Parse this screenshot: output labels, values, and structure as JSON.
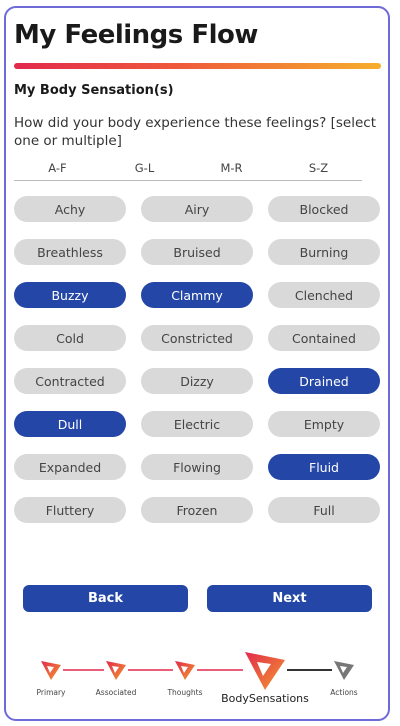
{
  "page": {
    "title": "My Feelings Flow"
  },
  "section": {
    "label": "My Body Sensation(s)",
    "question": "How did your body experience these feelings? [select one or multiple]"
  },
  "alpha_tabs": [
    "A-F",
    "G-L",
    "M-R",
    "S-Z"
  ],
  "sensations": [
    {
      "label": "Achy",
      "selected": false
    },
    {
      "label": "Airy",
      "selected": false
    },
    {
      "label": "Blocked",
      "selected": false
    },
    {
      "label": "Breathless",
      "selected": false
    },
    {
      "label": "Bruised",
      "selected": false
    },
    {
      "label": "Burning",
      "selected": false
    },
    {
      "label": "Buzzy",
      "selected": true
    },
    {
      "label": "Clammy",
      "selected": true
    },
    {
      "label": "Clenched",
      "selected": false
    },
    {
      "label": "Cold",
      "selected": false
    },
    {
      "label": "Constricted",
      "selected": false
    },
    {
      "label": "Contained",
      "selected": false
    },
    {
      "label": "Contracted",
      "selected": false
    },
    {
      "label": "Dizzy",
      "selected": false
    },
    {
      "label": "Drained",
      "selected": true
    },
    {
      "label": "Dull",
      "selected": true
    },
    {
      "label": "Electric",
      "selected": false
    },
    {
      "label": "Empty",
      "selected": false
    },
    {
      "label": "Expanded",
      "selected": false
    },
    {
      "label": "Flowing",
      "selected": false
    },
    {
      "label": "Fluid",
      "selected": true
    },
    {
      "label": "Fluttery",
      "selected": false
    },
    {
      "label": "Frozen",
      "selected": false
    },
    {
      "label": "Full",
      "selected": false
    }
  ],
  "buttons": {
    "back": "Back",
    "next": "Next"
  },
  "progress": {
    "steps": [
      {
        "label": "Primary",
        "icon": "arrow-triangle-icon",
        "active": false
      },
      {
        "label": "Associated",
        "icon": "arrow-triangle-icon",
        "active": false
      },
      {
        "label": "Thoughts",
        "icon": "arrow-triangle-icon",
        "active": false
      },
      {
        "label": "BodySensations",
        "icon": "arrow-triangle-icon",
        "active": true
      },
      {
        "label": "Actions",
        "icon": "arrow-triangle-icon",
        "active": false
      }
    ]
  },
  "colors": {
    "accent_blue": "#2446a6",
    "chip_grey": "#d9d9d9",
    "frame_border": "#6e6ad8",
    "gradient_start": "#e2294d",
    "gradient_end": "#f6ae2d",
    "future_step": "#777777"
  }
}
